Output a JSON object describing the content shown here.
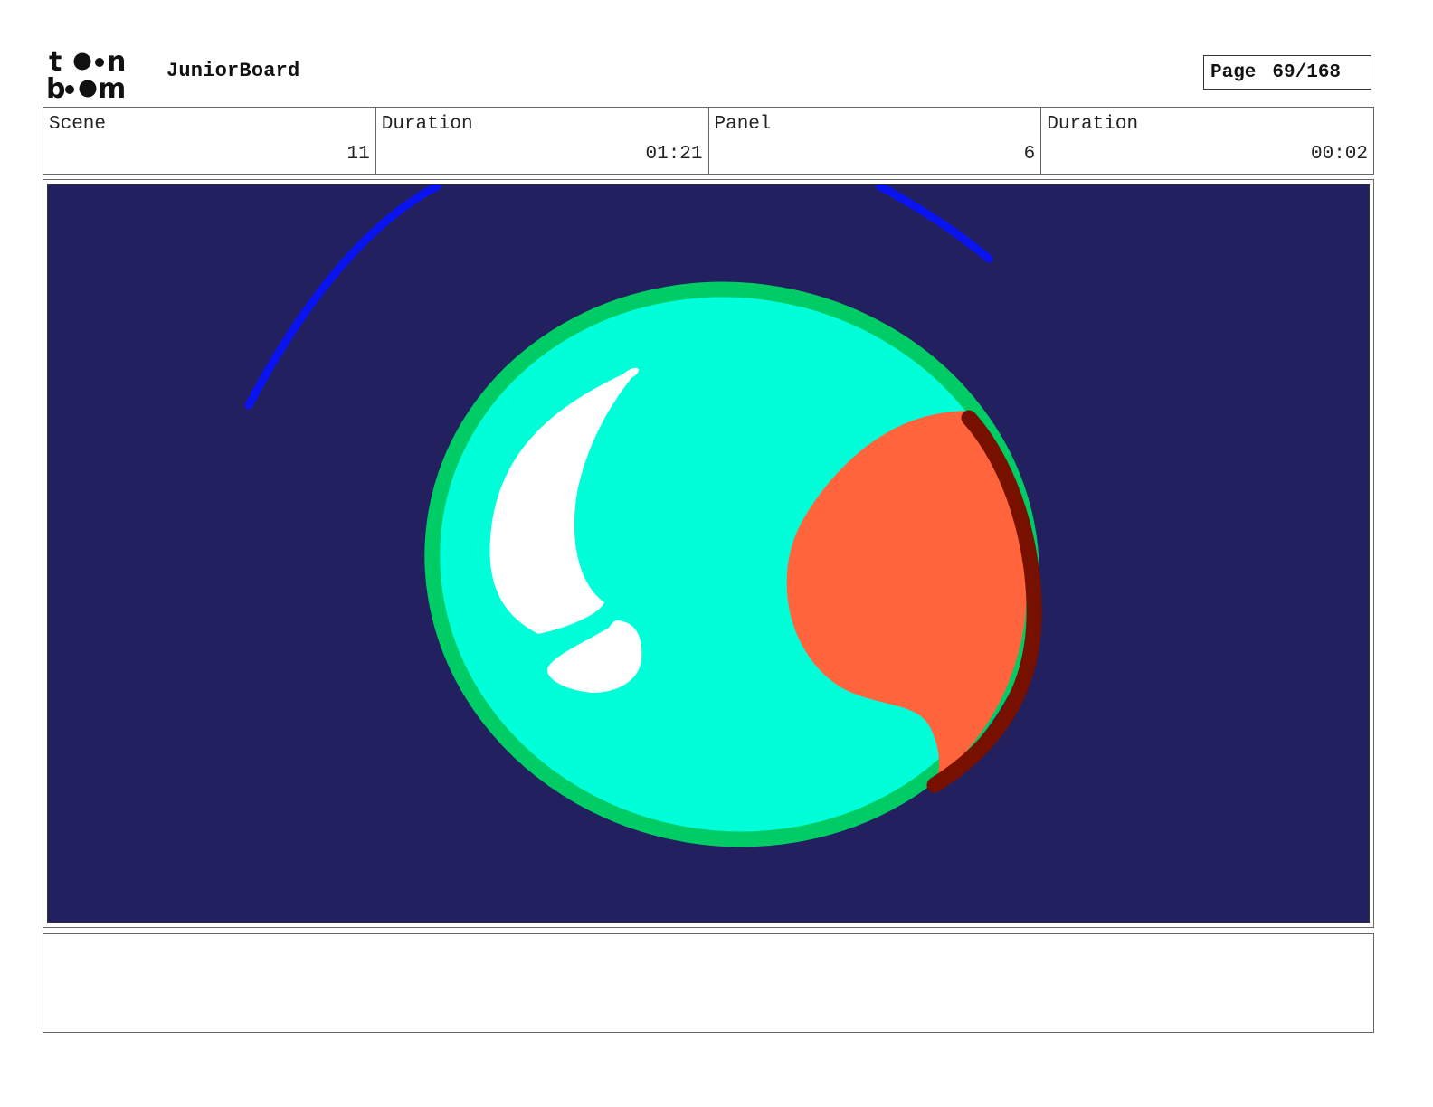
{
  "header": {
    "logo_text": [
      "t",
      "n",
      "b",
      "m"
    ],
    "app_title": "JuniorBoard",
    "page_label": "Page",
    "page_value": "69/168"
  },
  "info": {
    "scene_label": "Scene",
    "scene_value": "11",
    "scene_duration_label": "Duration",
    "scene_duration_value": "01:21",
    "panel_label": "Panel",
    "panel_value": "6",
    "panel_duration_label": "Duration",
    "panel_duration_value": "00:02"
  },
  "colors": {
    "background": "#22205f",
    "orbit_arc": "#0a14f0",
    "planet_outline": "#00cc66",
    "planet_fill": "#00ffd9",
    "highlight": "#ffffff",
    "shadow": "#ff643c",
    "rim_shadow": "#781000"
  },
  "notes": {
    "text": ""
  }
}
